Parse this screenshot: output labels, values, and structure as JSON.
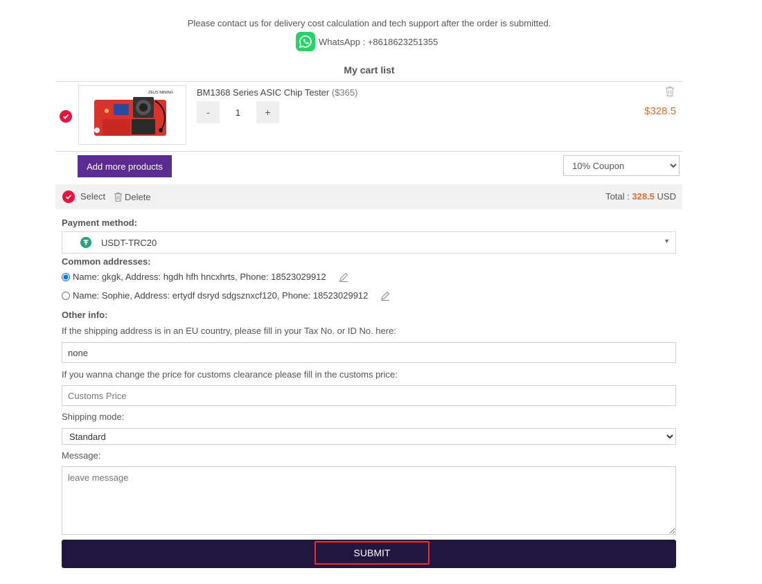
{
  "header": {
    "notice": "Please contact us for delivery cost calculation and tech support after the order is submitted.",
    "whatsapp_label": "WhatsApp : +8618623251355"
  },
  "cart": {
    "title": "My cart list",
    "items": [
      {
        "name": "BM1368 Series ASIC Chip Tester",
        "unit_price": "($365)",
        "image_brand": "ZEUS MINING",
        "quantity": "1",
        "minus": "-",
        "plus": "+",
        "line_price": "$328.5",
        "selected": true
      }
    ],
    "add_more_label": "Add more products",
    "coupon_selected": "10% Coupon",
    "select_label": "Select",
    "delete_label": "Delete",
    "total_label": "Total :",
    "total_value": "328.5",
    "currency": "USD"
  },
  "payment": {
    "label": "Payment method:",
    "selected": "USDT-TRC20",
    "icon": "tether-icon"
  },
  "addresses": {
    "label": "Common addresses:",
    "items": [
      {
        "text": "Name: gkgk, Address: hgdh hfh hncxhrts, Phone: 18523029912",
        "checked": true
      },
      {
        "text": "Name: Sophie, Address: ertydf dsryd sdgsznxcf120, Phone: 18523029912",
        "checked": false
      }
    ]
  },
  "other": {
    "label": "Other info:",
    "tax_prompt": "If the shipping address is in an EU country, please fill in your Tax No. or ID No. here:",
    "tax_value": "none",
    "customs_prompt": "If you wanna change the price for customs clearance please fill in the customs price:",
    "customs_placeholder": "Customs Price",
    "shipping_label": "Shipping mode:",
    "shipping_selected": "Standard",
    "message_label": "Message:",
    "message_placeholder": "leave message"
  },
  "submit_label": "SUBMIT",
  "colors": {
    "accent_red": "#e8123c",
    "price_orange": "#e36f2b",
    "purple_button": "#5a2c91",
    "submit_bg": "#201640",
    "whatsapp_green": "#25d366",
    "tether_green": "#26a17b"
  }
}
